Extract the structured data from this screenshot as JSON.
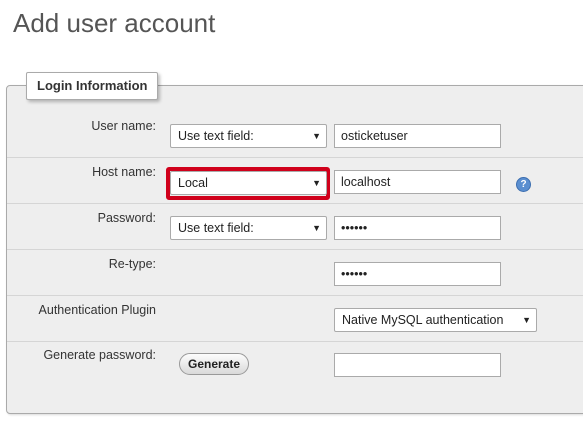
{
  "page": {
    "title": "Add user account"
  },
  "fieldset": {
    "legend": "Login Information"
  },
  "rows": {
    "user_name": {
      "label": "User name:",
      "select_value": "Use text field:",
      "input_value": "osticketuser"
    },
    "host_name": {
      "label": "Host name:",
      "select_value": "Local",
      "input_value": "localhost",
      "help_icon": "help-icon"
    },
    "password": {
      "label": "Password:",
      "select_value": "Use text field:",
      "input_value": "••••••"
    },
    "retype": {
      "label": "Re-type:",
      "input_value": "••••••"
    },
    "auth_plugin": {
      "label": "Authentication Plugin",
      "select_value": "Native MySQL authentication"
    },
    "generate": {
      "label": "Generate password:",
      "button_label": "Generate",
      "input_value": ""
    }
  },
  "colors": {
    "highlight": "#d0001b",
    "panel_bg": "#eeeeee"
  }
}
